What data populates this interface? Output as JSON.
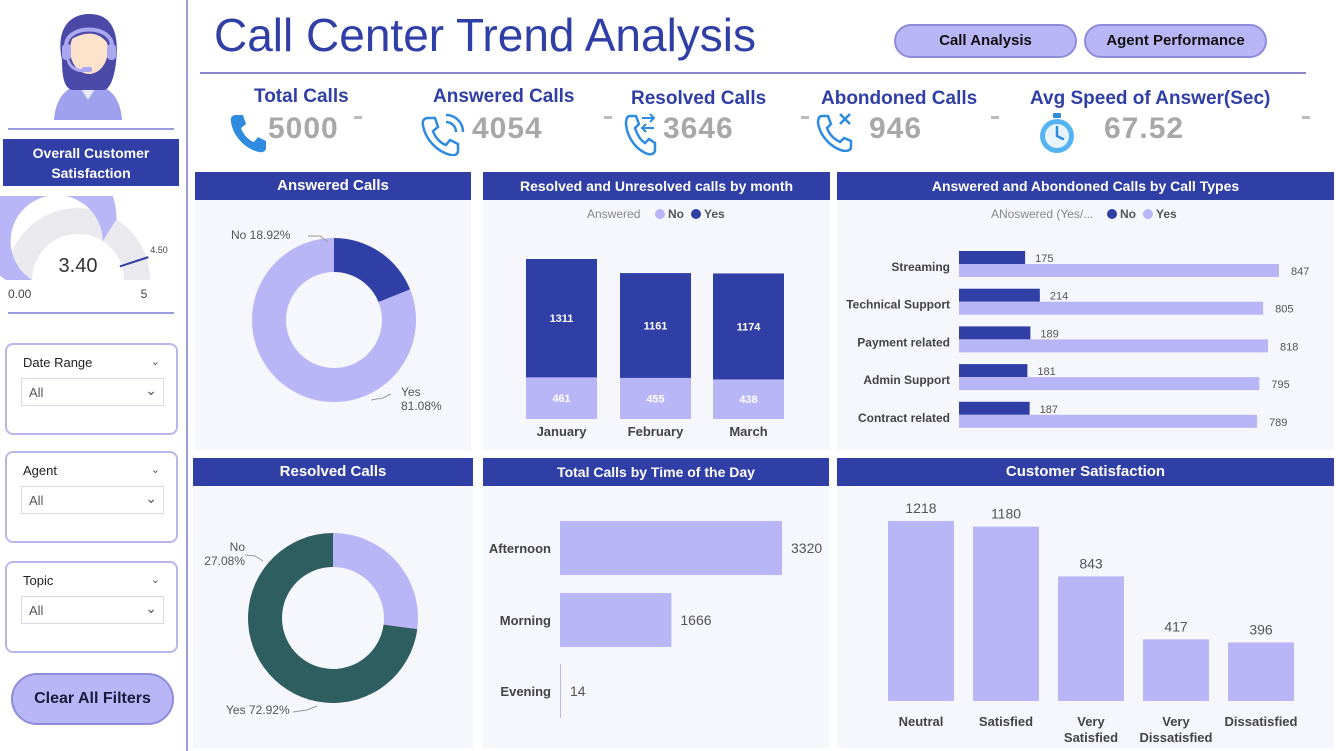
{
  "header": {
    "title": "Call Center Trend Analysis",
    "nav_call_analysis": "Call Analysis",
    "nav_agent_performance": "Agent Performance"
  },
  "colors": {
    "primary": "#2f3fa6",
    "lavender": "#b9b6f7",
    "teal": "#2e5e5f",
    "kpi_icon": "#2f8be0"
  },
  "kpis": [
    {
      "title": "Total Calls",
      "value": "5000",
      "icon": "phone-icon"
    },
    {
      "title": "Answered Calls",
      "value": "4054",
      "icon": "phone-ringing-icon"
    },
    {
      "title": "Resolved Calls",
      "value": "3646",
      "icon": "phone-transfer-icon"
    },
    {
      "title": "Abondoned Calls",
      "value": "946",
      "icon": "phone-missed-icon"
    },
    {
      "title": "Avg Speed of Answer(Sec)",
      "value": "67.52",
      "icon": "stopwatch-icon"
    }
  ],
  "sidebar": {
    "csat_title_line1": "Overall Customer",
    "csat_title_line2": "Satisfaction",
    "gauge": {
      "value": 3.4,
      "value_label": "3.40",
      "min_label": "0.00",
      "max_label": "5",
      "target": 4.5,
      "target_label": "4.50",
      "max": 5
    },
    "filters": [
      {
        "label": "Date Range",
        "value": "All"
      },
      {
        "label": "Agent",
        "value": "All"
      },
      {
        "label": "Topic",
        "value": "All"
      }
    ],
    "clear_button": "Clear All Filters"
  },
  "chart_data": [
    {
      "type": "pie",
      "title": "Answered Calls",
      "labels": [
        "No",
        "Yes"
      ],
      "values": [
        18.92,
        81.08
      ],
      "value_labels": [
        "18.92%",
        "81.08%"
      ],
      "colors": [
        "#2f3fa6",
        "#b9b6f7"
      ]
    },
    {
      "type": "bar",
      "title": "Resolved and Unresolved calls by month",
      "legend_title": "Answered",
      "categories": [
        "January",
        "February",
        "March"
      ],
      "series": [
        {
          "name": "No",
          "values": [
            461,
            455,
            438
          ],
          "color": "#b9b6f7"
        },
        {
          "name": "Yes",
          "values": [
            1311,
            1161,
            1174
          ],
          "color": "#2f3fa6"
        }
      ],
      "stacked": true
    },
    {
      "type": "bar",
      "orientation": "horizontal",
      "title": "Answered and Abondoned Calls  by Call Types",
      "legend_title": "ANoswered (Yes/...",
      "categories": [
        "Streaming",
        "Technical Support",
        "Payment related",
        "Admin Support",
        "Contract related"
      ],
      "series": [
        {
          "name": "No",
          "values": [
            175,
            214,
            189,
            181,
            187
          ],
          "color": "#2f3fa6"
        },
        {
          "name": "Yes",
          "values": [
            847,
            805,
            818,
            795,
            789
          ],
          "color": "#b9b6f7"
        }
      ],
      "xlim": [
        0,
        900
      ]
    },
    {
      "type": "pie",
      "title": "Resolved Calls",
      "labels": [
        "No",
        "Yes"
      ],
      "values": [
        27.08,
        72.92
      ],
      "value_labels": [
        "27.08%",
        "72.92%"
      ],
      "colors": [
        "#b9b6f7",
        "#2e5e5f"
      ]
    },
    {
      "type": "bar",
      "orientation": "horizontal",
      "title": "Total Calls by Time of the Day",
      "categories": [
        "Afternoon",
        "Morning",
        "Evening"
      ],
      "values": [
        3320,
        1666,
        14
      ],
      "xlim": [
        0,
        3320
      ]
    },
    {
      "type": "bar",
      "title": "Customer Satisfaction",
      "categories": [
        "Neutral",
        "Satisfied",
        "Very Satisfied",
        "Very Dissatisfied",
        "Dissatisfied"
      ],
      "values": [
        1218,
        1180,
        843,
        417,
        396
      ],
      "ylim": [
        0,
        1218
      ]
    }
  ]
}
